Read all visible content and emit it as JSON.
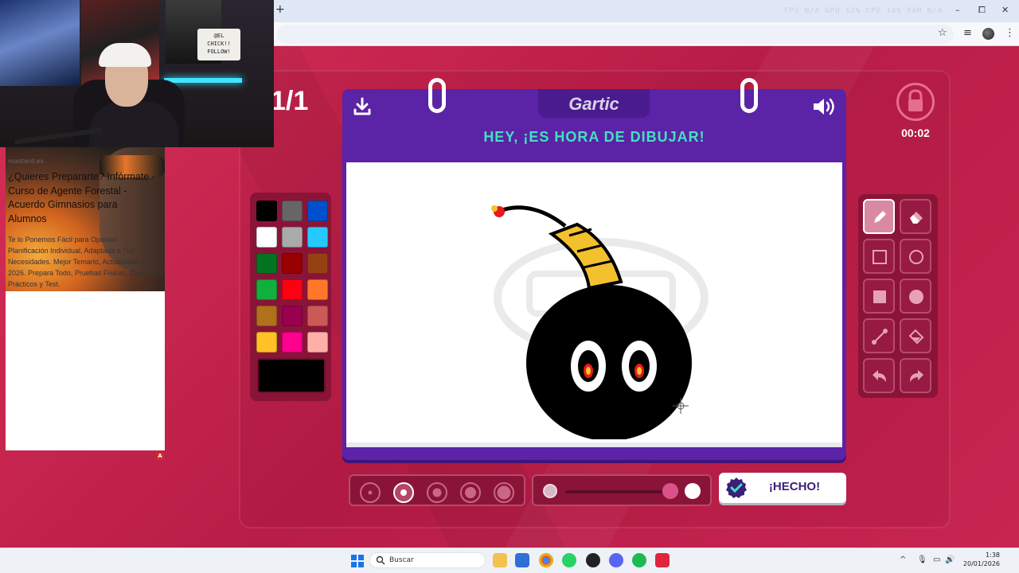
{
  "browser": {
    "new_tab_symbol": "+",
    "stats_text": "FPS N/A  GPU 12%  CPU 14%  RAM N/A",
    "window_controls": [
      "–",
      "⧠",
      "✕"
    ]
  },
  "webcam": {
    "sign_text": [
      "@EL",
      "CHICK!!",
      "FOLLOW!"
    ]
  },
  "ad": {
    "domain": "masterd.es",
    "title": "¿Quieres Prepararte? Infórmate - Curso de Agente Forestal - Acuerdo Gimnasios para Alumnos",
    "body": "Te lo Ponemos Fácil para Opositar. Planificación Individual, Adaptada a Tus Necesidades. Mejor Temario, Actualizado a 2026. Prepara Todo, Pruebas Físicas, Casos Prácticos y Test.",
    "badge": "A"
  },
  "game": {
    "round": "1/1",
    "logo": "Gartic",
    "prompt": "HEY, ¡ES HORA DE DIBUJAR!",
    "timer": "00:02",
    "done_label": "¡HECHO!",
    "colors": [
      [
        "#000000",
        "#666666",
        "#0050cd"
      ],
      [
        "#ffffff",
        "#aaaaaa",
        "#26c9ff"
      ],
      [
        "#017420",
        "#990000",
        "#964112"
      ],
      [
        "#11b03c",
        "#ff0013",
        "#ff7829"
      ],
      [
        "#b0701c",
        "#99004e",
        "#cb5a57"
      ],
      [
        "#ffc126",
        "#ff008f",
        "#feafa8"
      ]
    ],
    "selected_color": "#000000",
    "tools": [
      [
        "pencil-icon",
        "eraser-icon"
      ],
      [
        "rectangle-outline-icon",
        "ellipse-outline-icon"
      ],
      [
        "rectangle-filled-icon",
        "ellipse-filled-icon"
      ],
      [
        "line-icon",
        "fill-bucket-icon"
      ],
      [
        "undo-icon",
        "redo-icon"
      ]
    ],
    "brush_sizes": [
      1,
      2,
      3,
      4,
      5
    ],
    "selected_brush_size": 2,
    "opacity": 1
  },
  "taskbar": {
    "search_placeholder": "Buscar",
    "time": "1:38",
    "date": "20/01/2026"
  }
}
